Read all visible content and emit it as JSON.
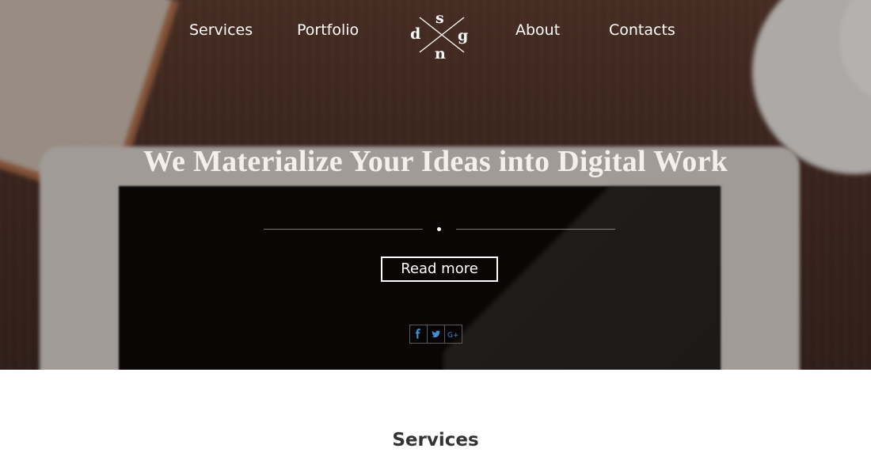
{
  "nav": {
    "items": [
      {
        "label": "Services"
      },
      {
        "label": "Portfolio"
      },
      {
        "label": "About"
      },
      {
        "label": "Contacts"
      }
    ],
    "logo": {
      "s": "s",
      "d": "d",
      "g": "g",
      "n": "n"
    }
  },
  "hero": {
    "headline": "We Materialize Your Ideas into Digital Work",
    "cta_label": "Read more",
    "social": [
      {
        "icon": "facebook-icon",
        "glyph": "f"
      },
      {
        "icon": "twitter-icon",
        "glyph": "🐦"
      },
      {
        "icon": "google-plus-icon",
        "glyph": "G+"
      }
    ]
  },
  "services": {
    "title": "Services"
  },
  "colors": {
    "social_icon": "#3e8fd6",
    "section_title": "#333333"
  }
}
